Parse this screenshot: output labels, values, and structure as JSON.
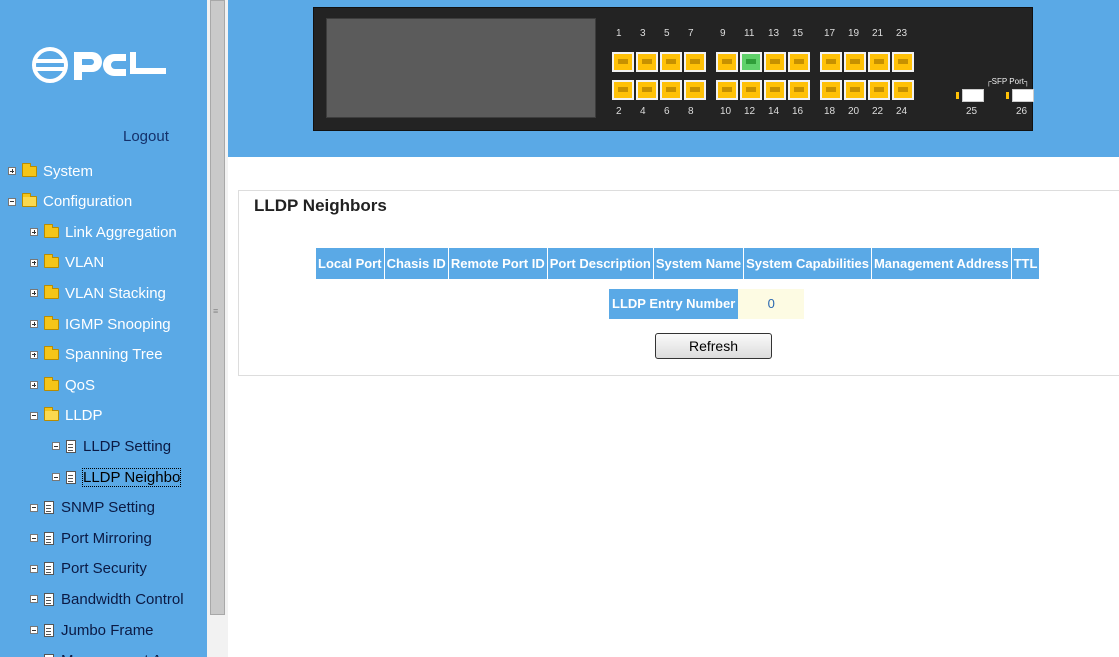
{
  "brand": {
    "logo_text": "PCi"
  },
  "sidebar": {
    "logout": "Logout",
    "items": [
      {
        "label": "System",
        "type": "folder",
        "toggle": "plus",
        "level": 0
      },
      {
        "label": "Configuration",
        "type": "folder-open",
        "toggle": "minus",
        "level": 0
      },
      {
        "label": "Link Aggregation",
        "type": "folder",
        "toggle": "plus",
        "level": 1
      },
      {
        "label": "VLAN",
        "type": "folder",
        "toggle": "plus",
        "level": 1
      },
      {
        "label": "VLAN Stacking",
        "type": "folder",
        "toggle": "plus",
        "level": 1
      },
      {
        "label": "IGMP Snooping",
        "type": "folder",
        "toggle": "plus",
        "level": 1
      },
      {
        "label": "Spanning Tree",
        "type": "folder",
        "toggle": "plus",
        "level": 1
      },
      {
        "label": "QoS",
        "type": "folder",
        "toggle": "plus",
        "level": 1
      },
      {
        "label": "LLDP",
        "type": "folder-open",
        "toggle": "minus",
        "level": 1
      },
      {
        "label": "LLDP Setting",
        "type": "doc",
        "toggle": "minus",
        "level": 2
      },
      {
        "label": "LLDP Neighbo",
        "type": "doc",
        "toggle": "minus",
        "level": 2,
        "selected": true
      },
      {
        "label": "SNMP Setting",
        "type": "doc",
        "toggle": "minus",
        "level": 1
      },
      {
        "label": "Port Mirroring",
        "type": "doc",
        "toggle": "minus",
        "level": 1
      },
      {
        "label": "Port Security",
        "type": "doc",
        "toggle": "minus",
        "level": 1
      },
      {
        "label": "Bandwidth Control",
        "type": "doc",
        "toggle": "minus",
        "level": 1
      },
      {
        "label": "Jumbo Frame",
        "type": "doc",
        "toggle": "minus",
        "level": 1
      },
      {
        "label": "Management Acce",
        "type": "doc",
        "toggle": "minus",
        "level": 1
      }
    ]
  },
  "switch_panel": {
    "top_ports": [
      "1",
      "3",
      "5",
      "7",
      "9",
      "11",
      "13",
      "15",
      "17",
      "19",
      "21",
      "23"
    ],
    "bottom_ports": [
      "2",
      "4",
      "6",
      "8",
      "10",
      "12",
      "14",
      "16",
      "18",
      "20",
      "22",
      "24"
    ],
    "active_port": "11",
    "sfp_label": "SFP Port",
    "sfp_ports": [
      "25",
      "26"
    ]
  },
  "main": {
    "section_title": "LLDP Neighbors",
    "table_headers": [
      "Local Port",
      "Chasis ID",
      "Remote Port ID",
      "Port Description",
      "System Name",
      "System Capabilities",
      "Management Address",
      "TTL"
    ],
    "entry_label": "LLDP Entry Number",
    "entry_value": "0",
    "refresh_label": "Refresh"
  },
  "colors": {
    "accent": "#5aa9e6",
    "header_bg": "#5aa9e6",
    "port_yellow": "#ffc107",
    "port_active": "#5fd16a"
  }
}
